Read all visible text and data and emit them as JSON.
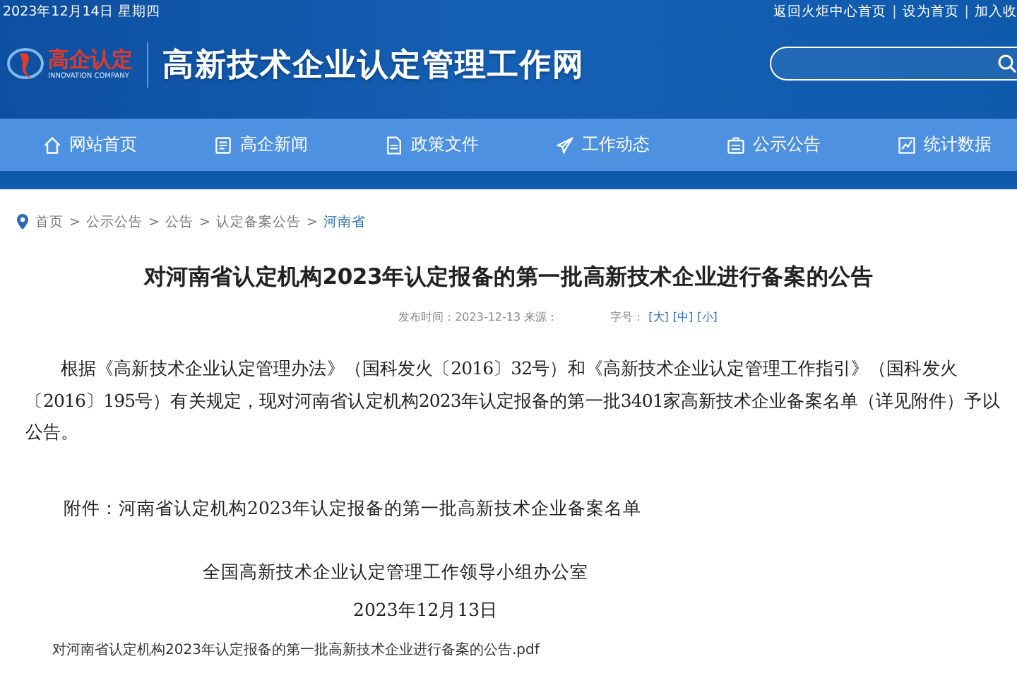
{
  "topbar": {
    "date": "2023年12月14日 星期四",
    "links": [
      "返回火炬中心首页",
      "设为首页",
      "加入收"
    ],
    "link_separator": "|"
  },
  "header": {
    "logo_text": "高企认定",
    "logo_sub": "INNOVATION COMPANY",
    "site_title": "高新技术企业认定管理工作网"
  },
  "nav": [
    {
      "label": "网站首页",
      "kind": "home"
    },
    {
      "label": "高企新闻",
      "kind": "news"
    },
    {
      "label": "政策文件",
      "kind": "doc"
    },
    {
      "label": "工作动态",
      "kind": "plane"
    },
    {
      "label": "公示公告",
      "kind": "board"
    },
    {
      "label": "统计数据",
      "kind": "chart"
    }
  ],
  "breadcrumb_separator": ">",
  "breadcrumb": [
    {
      "label": "首页",
      "selected": false
    },
    {
      "label": "公示公告",
      "selected": false
    },
    {
      "label": "公告",
      "selected": false
    },
    {
      "label": "认定备案公告",
      "selected": false
    },
    {
      "label": "河南省",
      "selected": true
    }
  ],
  "article": {
    "title": "对河南省认定机构2023年认定报备的第一批高新技术企业进行备案的公告",
    "meta": "发布时间：2023-12-13 来源：",
    "font_label": "字号：",
    "font_sizes": [
      "[大]",
      "[中]",
      "[小]"
    ],
    "body": "根据《高新技术企业认定管理办法》（国科发火〔2016〕32号）和《高新技术企业认定管理工作指引》（国科发火〔2016〕195号）有关规定，现对河南省认定机构2023年认定报备的第一批3401家高新技术企业备案名单（详见附件）予以公告。",
    "attachment": "附件：河南省认定机构2023年认定报备的第一批高新技术企业备案名单",
    "signature": "全国高新技术企业认定管理工作领导小组办公室",
    "date": "2023年12月13日",
    "file": "对河南省认定机构2023年认定报备的第一批高新技术企业进行备案的公告.pdf"
  }
}
